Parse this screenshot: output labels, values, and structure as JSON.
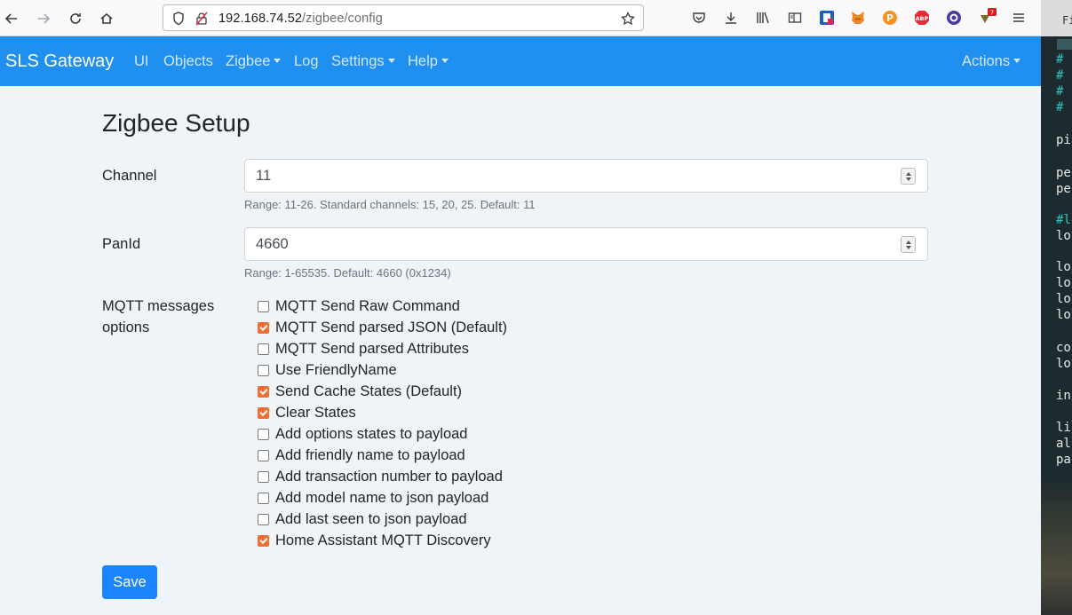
{
  "browser": {
    "url_host": "192.168.74.52",
    "url_path": "/zigbee/config",
    "badge_count": "7"
  },
  "navbar": {
    "brand": "SLS Gateway",
    "items": [
      {
        "label": "UI"
      },
      {
        "label": "Objects"
      },
      {
        "label": "Zigbee"
      },
      {
        "label": "Log"
      },
      {
        "label": "Settings"
      },
      {
        "label": "Help"
      }
    ],
    "actions": "Actions"
  },
  "form": {
    "title": "Zigbee Setup",
    "channel": {
      "label": "Channel",
      "value": "11",
      "help": "Range: 11-26. Standard channels: 15, 20, 25. Default: 11"
    },
    "panid": {
      "label": "PanId",
      "value": "4660",
      "help": "Range: 1-65535. Default: 4660 (0x1234)"
    },
    "mqtt": {
      "label_line1": "MQTT messages",
      "label_line2": "options",
      "options": [
        {
          "label": "MQTT Send Raw Command",
          "checked": false
        },
        {
          "label": "MQTT Send parsed JSON (Default)",
          "checked": true
        },
        {
          "label": "MQTT Send parsed Attributes",
          "checked": false
        },
        {
          "label": "Use FriendlyName",
          "checked": false
        },
        {
          "label": "Send Cache States (Default)",
          "checked": true
        },
        {
          "label": "Clear States",
          "checked": true
        },
        {
          "label": "Add options states to payload",
          "checked": false
        },
        {
          "label": "Add friendly name to payload",
          "checked": false
        },
        {
          "label": "Add transaction number to payload",
          "checked": false
        },
        {
          "label": "Add model name to json payload",
          "checked": false
        },
        {
          "label": "Add last seen to json payload",
          "checked": false
        },
        {
          "label": "Home Assistant MQTT Discovery",
          "checked": true
        }
      ]
    },
    "save_label": "Save"
  },
  "terminal": {
    "header": "Fi",
    "lines": [
      "#",
      "#",
      "#",
      "#",
      "pi",
      "pe",
      "pe",
      "#l",
      "lo",
      "lo",
      "lo",
      "lo",
      "lo",
      "co",
      "lo",
      "in",
      "li",
      "al",
      "pa"
    ]
  },
  "colors": {
    "navbar": "#1f8ff0",
    "checkbox_checked": "#f26d31",
    "save_button": "#1a85ff"
  }
}
